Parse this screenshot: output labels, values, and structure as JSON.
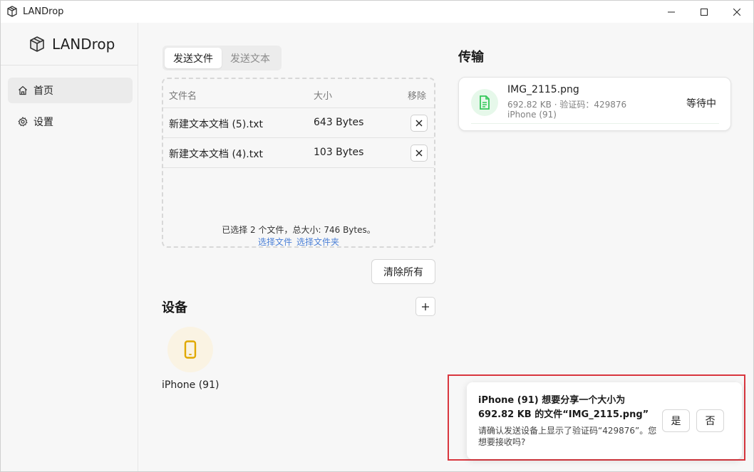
{
  "window": {
    "title": "LANDrop"
  },
  "sidebar": {
    "brand": "LANDrop",
    "items": [
      {
        "label": "首页",
        "icon": "home-icon",
        "active": true
      },
      {
        "label": "设置",
        "icon": "gear-icon",
        "active": false
      }
    ]
  },
  "send": {
    "tabs": [
      {
        "label": "发送文件",
        "active": true
      },
      {
        "label": "发送文本",
        "active": false
      }
    ],
    "table": {
      "headers": {
        "name": "文件名",
        "size": "大小",
        "remove": "移除"
      },
      "rows": [
        {
          "name": "新建文本文档 (5).txt",
          "size": "643 Bytes"
        },
        {
          "name": "新建文本文档 (4).txt",
          "size": "103 Bytes"
        }
      ]
    },
    "summary": "已选择 2 个文件，总大小: 746 Bytes。",
    "pick_files": "选择文件",
    "pick_folder": "选择文件夹",
    "clear_all": "清除所有"
  },
  "devices": {
    "title": "设备",
    "items": [
      {
        "name": "iPhone (91)",
        "icon": "phone-icon"
      }
    ]
  },
  "transfers": {
    "title": "传输",
    "items": [
      {
        "file": "IMG_2115.png",
        "meta": "692.82 KB · 验证码：429876",
        "device": "iPhone (91)",
        "status": "等待中",
        "icon": "document-icon"
      }
    ]
  },
  "dialog": {
    "title": "iPhone (91) 想要分享一个大小为 692.82 KB 的文件“IMG_2115.png”",
    "body": "请确认发送设备上显示了验证码“429876”。您想要接收吗?",
    "yes": "是",
    "no": "否"
  },
  "colors": {
    "accent_link": "#4a7fd6",
    "highlight": "#d9363e",
    "file_icon": "#34c759",
    "phone_icon": "#e0a800"
  }
}
